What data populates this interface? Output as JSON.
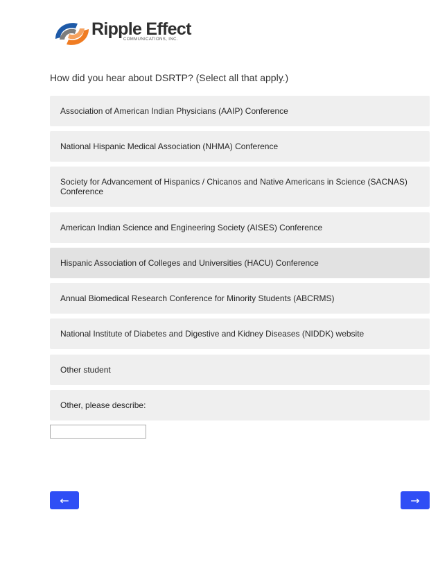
{
  "logo": {
    "name": "Ripple Effect",
    "subtitle": "COMMUNICATIONS, INC.",
    "colors": {
      "blue": "#1e5aa8",
      "orange": "#f07c22",
      "gray": "#7d7d7d"
    }
  },
  "question": "How did you hear about DSRTP? (Select all that apply.)",
  "options": [
    {
      "label": "Association of American Indian Physicians (AAIP) Conference"
    },
    {
      "label": "National Hispanic Medical Association (NHMA) Conference"
    },
    {
      "label": "Society for Advancement of Hispanics / Chicanos and Native Americans in Science (SACNAS) Conference"
    },
    {
      "label": "American Indian Science and Engineering Society (AISES) Conference"
    },
    {
      "label": "Hispanic Association of Colleges and Universities (HACU) Conference"
    },
    {
      "label": "Annual Biomedical Research Conference for Minority Students (ABCRMS)"
    },
    {
      "label": "National Institute of Diabetes and Digestive and Kidney Diseases (NIDDK) website"
    },
    {
      "label": "Other student"
    },
    {
      "label": "Other, please describe:"
    }
  ],
  "other_input": {
    "value": "",
    "placeholder": ""
  },
  "nav": {
    "back_label": "←",
    "next_label": "→",
    "accent": "#2f4ef5"
  }
}
